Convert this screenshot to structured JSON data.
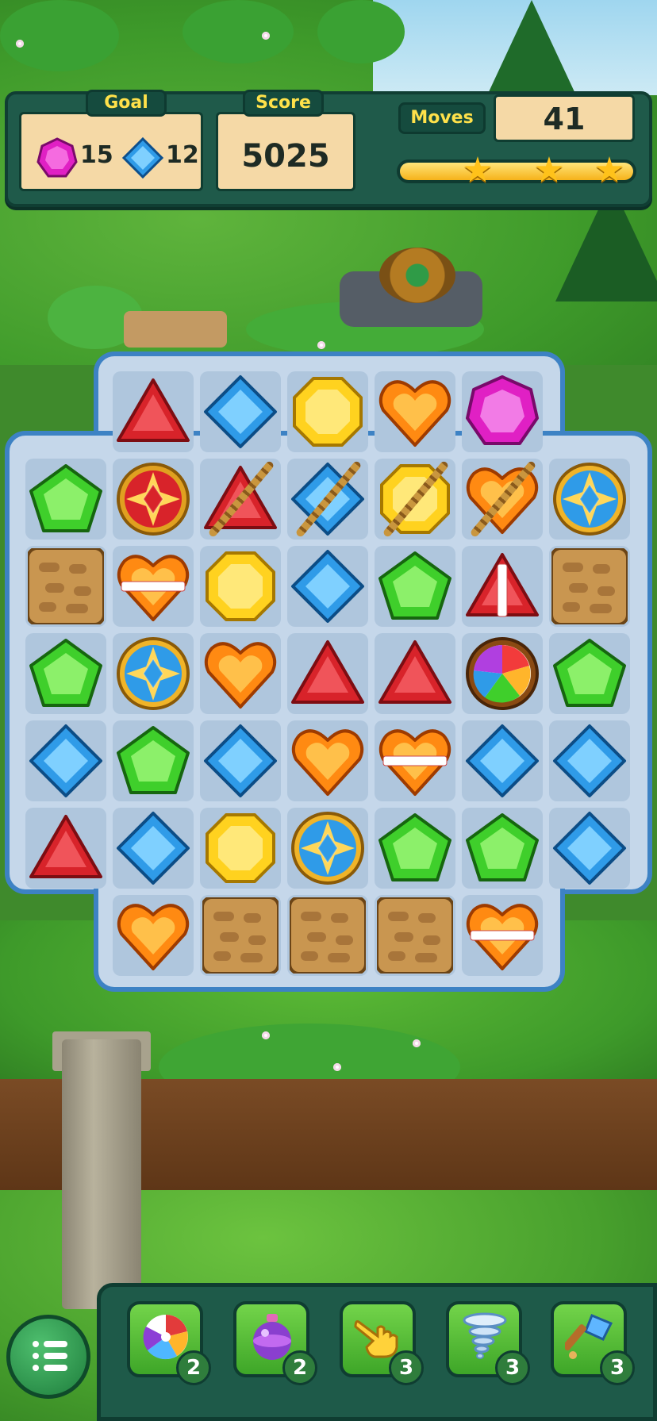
{
  "hud": {
    "goal_label": "Goal",
    "goals": [
      {
        "gem": "magenta-heptagon-gem",
        "count": "15"
      },
      {
        "gem": "blue-diamond-gem",
        "count": "12"
      }
    ],
    "score_label": "Score",
    "score_value": "5025",
    "moves_label": "Moves",
    "moves_value": "41",
    "progress": 1.0,
    "stars": 3
  },
  "board": {
    "rows": [
      [
        "none",
        "red-triangle",
        "blue-diamond",
        "yellow-octagon",
        "orange-heart",
        "magenta-heptagon",
        "none"
      ],
      [
        "green-pentagon",
        "red-medallion",
        "red-triangle-rope",
        "blue-diamond-rope",
        "yellow-octagon-rope",
        "orange-heart-rope",
        "blue-medallion"
      ],
      [
        "dirt-block",
        "orange-heart-striped",
        "yellow-octagon",
        "blue-diamond",
        "green-pentagon",
        "red-triangle-striped-v",
        "dirt-block"
      ],
      [
        "green-pentagon",
        "blue-medallion",
        "orange-heart",
        "red-triangle",
        "red-triangle",
        "rainbow-orb",
        "green-pentagon"
      ],
      [
        "blue-diamond",
        "green-pentagon",
        "blue-diamond",
        "orange-heart",
        "orange-heart-striped",
        "blue-diamond",
        "blue-diamond"
      ],
      [
        "red-triangle",
        "blue-diamond",
        "yellow-octagon",
        "blue-medallion",
        "green-pentagon",
        "green-pentagon",
        "blue-diamond"
      ],
      [
        "none",
        "orange-heart",
        "dirt-block",
        "dirt-block",
        "dirt-block",
        "orange-heart-striped",
        "none"
      ]
    ]
  },
  "boosters": [
    {
      "name": "lollipop-booster",
      "count": "2"
    },
    {
      "name": "bomb-booster",
      "count": "2"
    },
    {
      "name": "hand-booster",
      "count": "3"
    },
    {
      "name": "tornado-booster",
      "count": "3"
    },
    {
      "name": "hammer-booster",
      "count": "3"
    }
  ],
  "colors": {
    "red": "#d8232a",
    "blue": "#2f9be8",
    "yellow": "#ffd21f",
    "orange": "#ff8a12",
    "green": "#3fcf2b",
    "magenta": "#e020c4",
    "dirt": "#c99650"
  }
}
